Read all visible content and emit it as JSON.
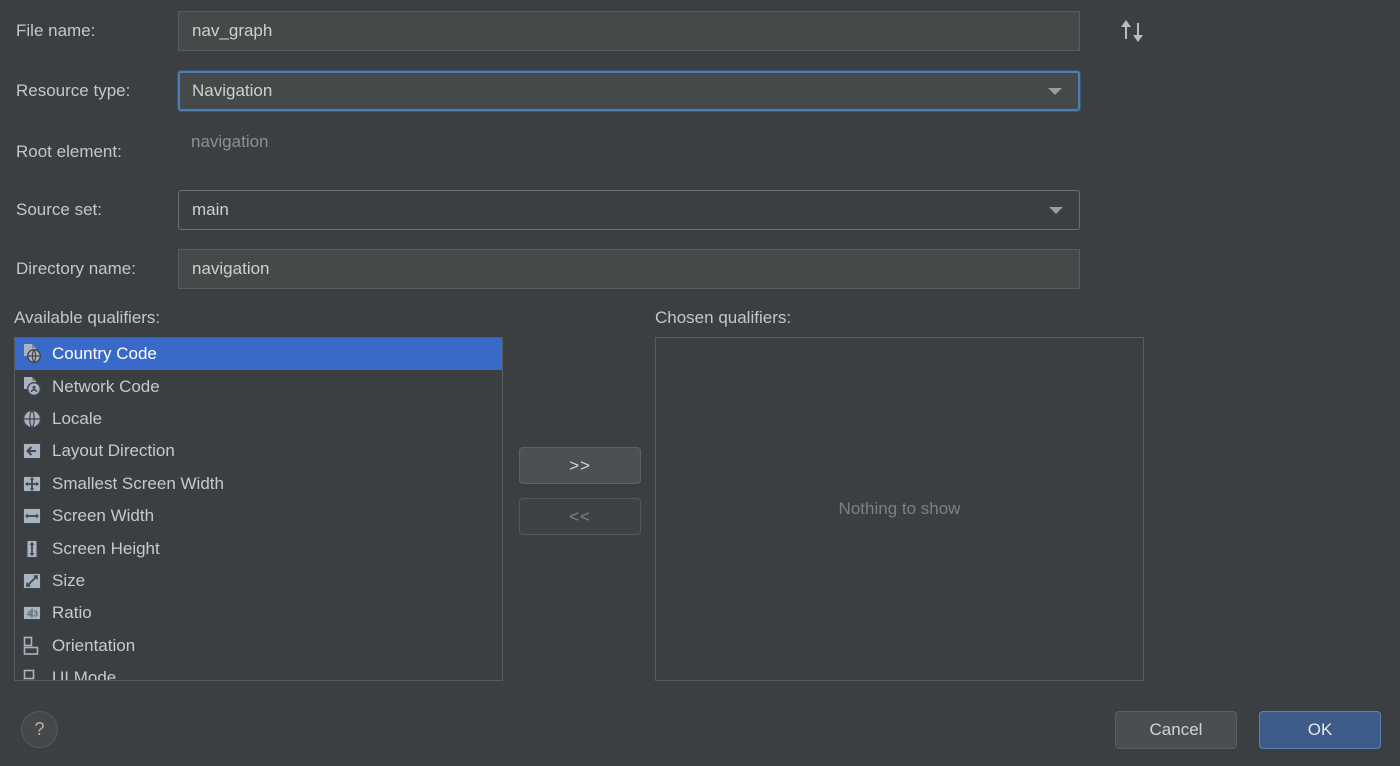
{
  "dialog": {
    "theme_bg": "#3c3f41",
    "accent": "#3a6ac9",
    "focus_border": "#4a7ebb"
  },
  "form": {
    "rows": [
      {
        "label": "File name:",
        "value": "nav_graph",
        "type": "text"
      },
      {
        "label": "Resource type:",
        "value": "Navigation",
        "type": "combo-focused"
      },
      {
        "label": "Root element:",
        "value": "navigation",
        "type": "static"
      },
      {
        "label": "Source set:",
        "value": "main",
        "type": "combo"
      },
      {
        "label": "Directory name:",
        "value": "navigation",
        "type": "text"
      }
    ],
    "sort_icon": "sort-up-down-icon"
  },
  "qualifiers": {
    "available_title": "Available qualifiers:",
    "chosen_title": "Chosen qualifiers:",
    "chosen_empty_text": "Nothing to show",
    "available_items": [
      {
        "label": "Country Code",
        "icon": "country-code-icon",
        "selected": true
      },
      {
        "label": "Network Code",
        "icon": "network-code-icon",
        "selected": false
      },
      {
        "label": "Locale",
        "icon": "locale-globe-icon",
        "selected": false
      },
      {
        "label": "Layout Direction",
        "icon": "layout-direction-icon",
        "selected": false
      },
      {
        "label": "Smallest Screen Width",
        "icon": "smallest-screen-width-icon",
        "selected": false
      },
      {
        "label": "Screen Width",
        "icon": "screen-width-icon",
        "selected": false
      },
      {
        "label": "Screen Height",
        "icon": "screen-height-icon",
        "selected": false
      },
      {
        "label": "Size",
        "icon": "size-icon",
        "selected": false
      },
      {
        "label": "Ratio",
        "icon": "ratio-icon",
        "selected": false
      },
      {
        "label": "Orientation",
        "icon": "orientation-icon",
        "selected": false
      },
      {
        "label": "UI Mode",
        "icon": "ui-mode-icon",
        "selected": false
      }
    ],
    "add_label": ">>",
    "remove_label": "<<"
  },
  "footer": {
    "help_label": "?",
    "cancel_label": "Cancel",
    "ok_label": "OK"
  }
}
